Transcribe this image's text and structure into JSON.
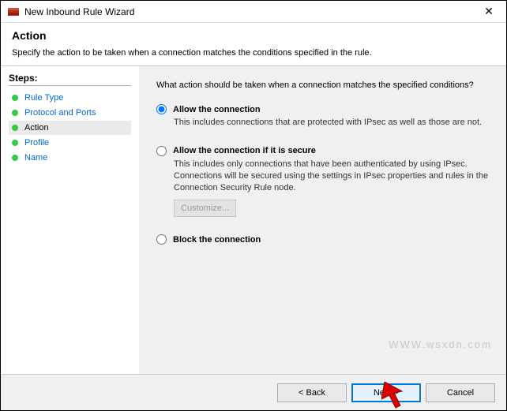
{
  "window": {
    "title": "New Inbound Rule Wizard"
  },
  "header": {
    "title": "Action",
    "subtitle": "Specify the action to be taken when a connection matches the conditions specified in the rule."
  },
  "sidebar": {
    "steps_label": "Steps:",
    "items": [
      {
        "label": "Rule Type",
        "active": false
      },
      {
        "label": "Protocol and Ports",
        "active": false
      },
      {
        "label": "Action",
        "active": true
      },
      {
        "label": "Profile",
        "active": false
      },
      {
        "label": "Name",
        "active": false
      }
    ]
  },
  "content": {
    "intro": "What action should be taken when a connection matches the specified conditions?",
    "options": [
      {
        "label": "Allow the connection",
        "desc": "This includes connections that are protected with IPsec as well as those are not.",
        "selected": true
      },
      {
        "label": "Allow the connection if it is secure",
        "desc": "This includes only connections that have been authenticated by using IPsec.  Connections will be secured using the settings in IPsec properties and rules in the Connection Security Rule node.",
        "selected": false,
        "customize_label": "Customize..."
      },
      {
        "label": "Block the connection",
        "desc": "",
        "selected": false
      }
    ]
  },
  "footer": {
    "back": "< Back",
    "next": "Next >",
    "cancel": "Cancel"
  },
  "watermark": "WWW.wsxdn.com"
}
